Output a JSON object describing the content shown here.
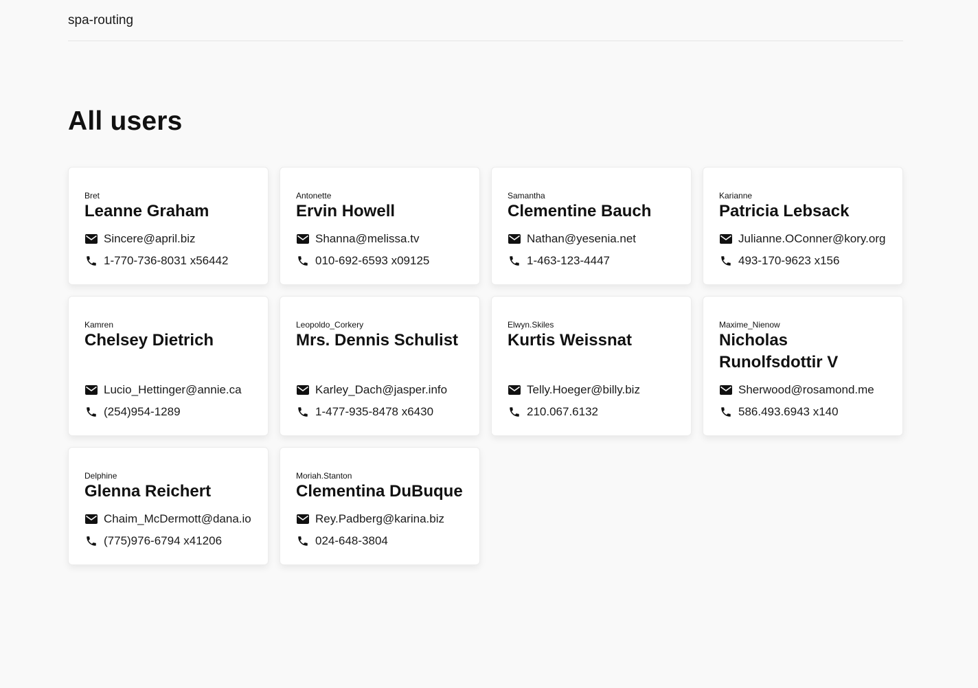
{
  "header": {
    "brand": "spa-routing"
  },
  "page": {
    "title": "All users"
  },
  "users": [
    {
      "username": "Bret",
      "name": "Leanne Graham",
      "email": "Sincere@april.biz",
      "phone": "1-770-736-8031 x56442"
    },
    {
      "username": "Antonette",
      "name": "Ervin Howell",
      "email": "Shanna@melissa.tv",
      "phone": "010-692-6593 x09125"
    },
    {
      "username": "Samantha",
      "name": "Clementine Bauch",
      "email": "Nathan@yesenia.net",
      "phone": "1-463-123-4447"
    },
    {
      "username": "Karianne",
      "name": "Patricia Lebsack",
      "email": "Julianne.OConner@kory.org",
      "phone": "493-170-9623 x156"
    },
    {
      "username": "Kamren",
      "name": "Chelsey Dietrich",
      "email": "Lucio_Hettinger@annie.ca",
      "phone": "(254)954-1289"
    },
    {
      "username": "Leopoldo_Corkery",
      "name": "Mrs. Dennis Schulist",
      "email": "Karley_Dach@jasper.info",
      "phone": "1-477-935-8478 x6430"
    },
    {
      "username": "Elwyn.Skiles",
      "name": "Kurtis Weissnat",
      "email": "Telly.Hoeger@billy.biz",
      "phone": "210.067.6132"
    },
    {
      "username": "Maxime_Nienow",
      "name": "Nicholas Runolfsdottir V",
      "email": "Sherwood@rosamond.me",
      "phone": "586.493.6943 x140"
    },
    {
      "username": "Delphine",
      "name": "Glenna Reichert",
      "email": "Chaim_McDermott@dana.io",
      "phone": "(775)976-6794 x41206"
    },
    {
      "username": "Moriah.Stanton",
      "name": "Clementina DuBuque",
      "email": "Rey.Padberg@karina.biz",
      "phone": "024-648-3804"
    }
  ],
  "icons": {
    "email": "envelope-icon",
    "phone": "phone-icon"
  }
}
